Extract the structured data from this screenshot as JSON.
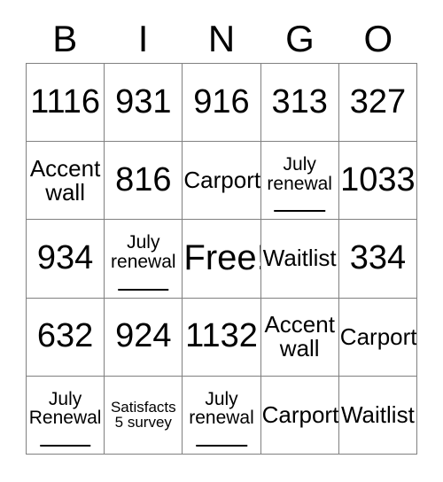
{
  "card": {
    "header_letters": [
      "B",
      "I",
      "N",
      "G",
      "O"
    ],
    "rows": [
      [
        {
          "text": "1116",
          "style": "num",
          "line": false
        },
        {
          "text": "931",
          "style": "num",
          "line": false
        },
        {
          "text": "916",
          "style": "num",
          "line": false
        },
        {
          "text": "313",
          "style": "num",
          "line": false
        },
        {
          "text": "327",
          "style": "num",
          "line": false
        }
      ],
      [
        {
          "text": "Accent wall",
          "style": "wrap",
          "line": false
        },
        {
          "text": "816",
          "style": "num",
          "line": false
        },
        {
          "text": "Carport",
          "style": "word",
          "line": false
        },
        {
          "text": "July renewal",
          "style": "small",
          "line": true
        },
        {
          "text": "1033",
          "style": "num",
          "line": false
        }
      ],
      [
        {
          "text": "934",
          "style": "num",
          "line": false
        },
        {
          "text": "July renewal",
          "style": "small",
          "line": true
        },
        {
          "text": "Free!",
          "style": "free",
          "line": false
        },
        {
          "text": "Waitlist",
          "style": "word",
          "line": false
        },
        {
          "text": "334",
          "style": "num",
          "line": false
        }
      ],
      [
        {
          "text": "632",
          "style": "num",
          "line": false
        },
        {
          "text": "924",
          "style": "num",
          "line": false
        },
        {
          "text": "1132",
          "style": "num",
          "line": false
        },
        {
          "text": "Accent wall",
          "style": "wrap",
          "line": false
        },
        {
          "text": "Carport",
          "style": "word",
          "line": false
        }
      ],
      [
        {
          "text": "July Renewal",
          "style": "small",
          "line": true
        },
        {
          "text": "Satisfacts 5 survey",
          "style": "tiny",
          "line": false
        },
        {
          "text": "July renewal",
          "style": "small",
          "line": true
        },
        {
          "text": "Carport",
          "style": "word",
          "line": false
        },
        {
          "text": "Waitlist",
          "style": "word",
          "line": false
        }
      ]
    ]
  },
  "colors": {
    "border": "#808080",
    "text": "#000000",
    "background": "#ffffff"
  }
}
